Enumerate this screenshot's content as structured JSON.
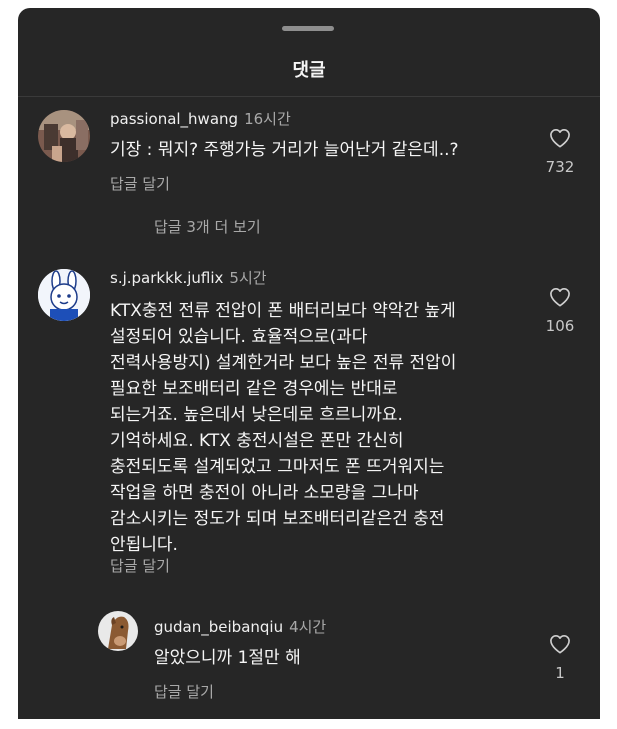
{
  "sheet": {
    "title": "댓글"
  },
  "comments": [
    {
      "username": "passional_hwang",
      "time": "16시간",
      "text": "기장 : 뭐지? 주행가능 거리가 늘어난거 같은데..?",
      "reply_label": "답글 달기",
      "like_count": "732",
      "view_replies_label": "답글 3개 더 보기"
    },
    {
      "username": "s.j.parkkk.juflix",
      "time": "5시간",
      "text": "KTX충전 전류 전압이  폰 배터리보다 약악간 높게\n설정되어 있습니다. 효율적으로(과다\n전력사용방지) 설계한거라 보다 높은 전류 전압이\n필요한 보조배터리 같은 경우에는 반대로\n되는거죠. 높은데서 낮은데로 흐르니까요.\n기억하세요. KTX 충전시설은 폰만 간신히\n충전되도록 설계되었고 그마저도 폰 뜨거워지는\n작업을 하면 충전이 아니라 소모량을 그나마\n감소시키는 정도가 되며 보조배터리같은건 충전\n안됩니다.",
      "reply_label": "답글 달기",
      "like_count": "106"
    },
    {
      "username": "gudan_beibanqiu",
      "time": "4시간",
      "text": "알았으니까 1절만 해",
      "reply_label": "답글 달기",
      "like_count": "1"
    }
  ],
  "icons": {
    "like": "heart-outline-icon"
  },
  "colors": {
    "background": "#262626",
    "text_primary": "#f5f5f5",
    "text_secondary": "#a8a8a8"
  }
}
